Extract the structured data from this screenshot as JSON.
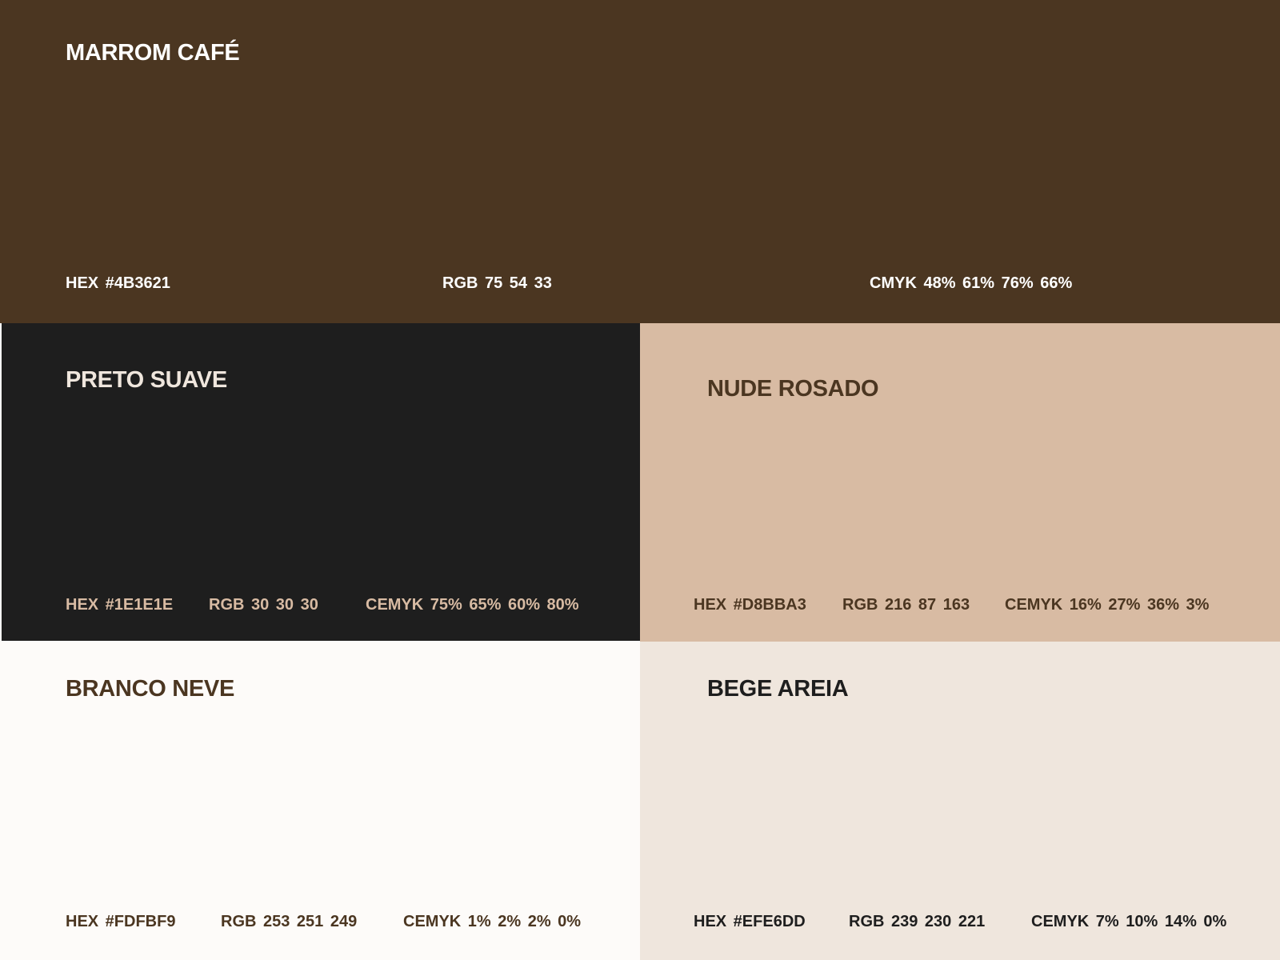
{
  "palette": [
    {
      "name": "MARROM CAFÉ",
      "background": "#4B3621",
      "title_color": "#FFFFFF",
      "text_color": "#FFFFFF",
      "hex_label": "HEX  #4B3621",
      "rgb_label": "RGB  75  54  33",
      "cmyk_label": "CMYK  48%  61%  76%  66%"
    },
    {
      "name": "PRETO SUAVE",
      "background": "#1E1E1E",
      "title_color": "#EFE6DD",
      "text_color": "#D8BBA3",
      "hex_label": "HEX  #1E1E1E",
      "rgb_label": "RGB  30  30  30",
      "cmyk_label": "CEMYK  75%  65%  60%  80%"
    },
    {
      "name": "NUDE ROSADO",
      "background": "#D8BBA3",
      "title_color": "#4B3621",
      "text_color": "#4B3621",
      "hex_label": "HEX  #D8BBA3",
      "rgb_label": "RGB  216  87  163",
      "cmyk_label": "CEMYK  16%  27%  36%  3%"
    },
    {
      "name": "BRANCO NEVE",
      "background": "#FDFBF9",
      "title_color": "#4B3621",
      "text_color": "#4B3621",
      "hex_label": "HEX  #FDFBF9",
      "rgb_label": "RGB  253  251  249",
      "cmyk_label": "CEMYK  1%  2%  2%  0%"
    },
    {
      "name": "BEGE AREIA",
      "background": "#EFE6DD",
      "title_color": "#1E1E1E",
      "text_color": "#1E1E1E",
      "hex_label": "HEX  #EFE6DD",
      "rgb_label": "RGB  239  230  221",
      "cmyk_label": "CEMYK  7%  10%  14%  0%"
    }
  ]
}
